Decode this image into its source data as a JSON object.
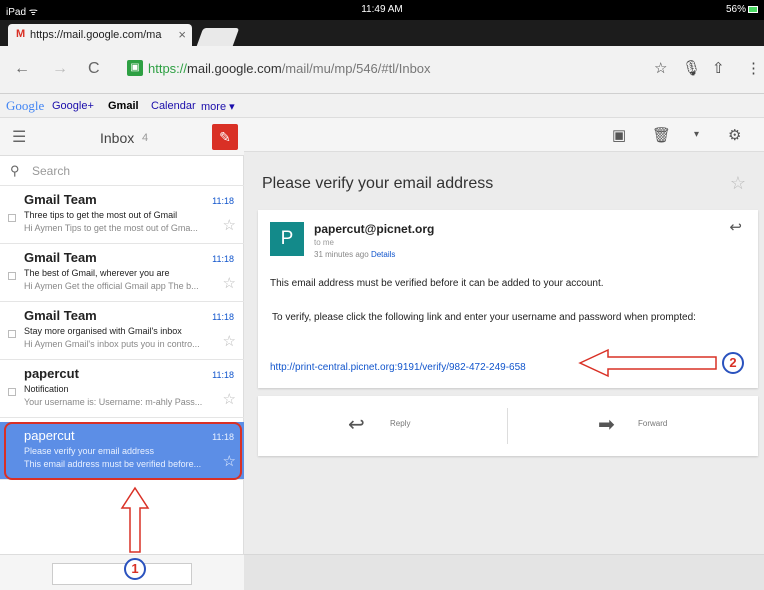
{
  "status_bar": {
    "device": "iPad",
    "wifi": "wifi-icon",
    "time": "11:49 AM",
    "battery": "56%"
  },
  "tab": {
    "favicon": "M",
    "title": "https://mail.google.com/ma",
    "close": "×"
  },
  "address_bar": {
    "scheme": "https://",
    "host": "mail.google.com",
    "path": "/mail/mu/mp/546/#tl/Inbox"
  },
  "google_bar": {
    "logo": "Google",
    "links": [
      "Google+",
      "Gmail",
      "Calendar",
      "more ▾"
    ],
    "active": "Gmail"
  },
  "inbox": {
    "label": "Inbox",
    "count": "4",
    "search_placeholder": "Search",
    "messages": [
      {
        "from": "Gmail Team",
        "time": "11:18",
        "subject": "Three tips to get the most out of Gmail",
        "preview": "Hi Aymen Tips to get the most out of Gma...",
        "selected": false
      },
      {
        "from": "Gmail Team",
        "time": "11:18",
        "subject": "The best of Gmail, wherever you are",
        "preview": "Hi Aymen Get the official Gmail app The b...",
        "selected": false
      },
      {
        "from": "Gmail Team",
        "time": "11:18",
        "subject": "Stay more organised with Gmail's inbox",
        "preview": "Hi Aymen Gmail's inbox puts you in contro...",
        "selected": false
      },
      {
        "from": "papercut",
        "time": "11:18",
        "subject": "Notification",
        "preview": "Your username is: Username: m-ahly Pass...",
        "selected": false
      },
      {
        "from": "papercut",
        "time": "11:18",
        "subject": "Please verify your email address",
        "preview": "This email address must be verified before...",
        "selected": true
      }
    ]
  },
  "message": {
    "title": "Please verify your email address",
    "sender": "papercut@picnet.org",
    "avatar": "P",
    "to": "to me",
    "ago": "31 minutes ago",
    "details": "Details",
    "body1": "This email address must be verified before it can be added to your account.",
    "body2": "To verify, please click the following link and enter your username and password when prompted:",
    "link": "http://print-central.picnet.org:9191/verify/982-472-249-658",
    "reply": "Reply",
    "forward": "Forward"
  },
  "annotations": {
    "marker1": "1",
    "marker2": "2",
    "color": "#d93025"
  },
  "colors": {
    "gmail_red": "#d93025",
    "selected_row": "#5c8ee6",
    "link_blue": "#1155cc",
    "avatar_teal": "#138a8a"
  }
}
